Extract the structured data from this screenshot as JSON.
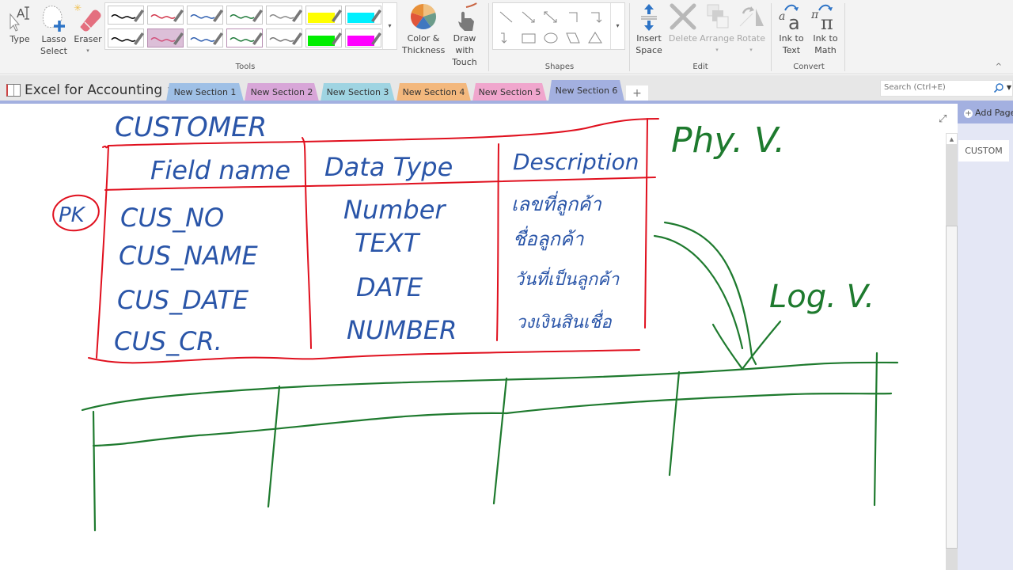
{
  "ribbon": {
    "tools": {
      "type_label": "Type",
      "lasso_label_line1": "Lasso",
      "lasso_label_line2": "Select",
      "eraser_label": "Eraser",
      "color_thickness_line1": "Color &",
      "color_thickness_line2": "Thickness",
      "draw_touch_line1": "Draw with",
      "draw_touch_line2": "Touch",
      "group_label": "Tools",
      "pens": [
        {
          "color": "#000000",
          "kind": "pen"
        },
        {
          "color": "#d2344a",
          "kind": "pen"
        },
        {
          "color": "#2f5fb0",
          "kind": "pen"
        },
        {
          "color": "#1f7a3a",
          "kind": "pen"
        },
        {
          "color": "#888888",
          "kind": "pen"
        },
        {
          "color": "#ffff00",
          "kind": "highlighter"
        },
        {
          "color": "#00f0ff",
          "kind": "highlighter"
        },
        {
          "color": "#000000",
          "kind": "pen"
        },
        {
          "color": "#d2507a",
          "kind": "pen",
          "selected": true
        },
        {
          "color": "#2f5fb0",
          "kind": "pen"
        },
        {
          "color": "#1f7a3a",
          "kind": "pen",
          "outlined": true
        },
        {
          "color": "#777777",
          "kind": "pen"
        },
        {
          "color": "#00ee00",
          "kind": "highlighter"
        },
        {
          "color": "#ff00ff",
          "kind": "highlighter"
        }
      ]
    },
    "shapes": {
      "group_label": "Shapes"
    },
    "edit": {
      "insert_space_line1": "Insert",
      "insert_space_line2": "Space",
      "delete_label": "Delete",
      "arrange_label": "Arrange",
      "rotate_label": "Rotate",
      "group_label": "Edit"
    },
    "convert": {
      "ink_to_text_line1": "Ink to",
      "ink_to_text_line2": "Text",
      "ink_to_math_line1": "Ink to",
      "ink_to_math_line2": "Math",
      "group_label": "Convert"
    }
  },
  "notebook": {
    "name": "Excel for Accounting"
  },
  "sections": [
    {
      "label": "New Section 1",
      "color": "#9fc0e6"
    },
    {
      "label": "New Section 2",
      "color": "#d8a6d8"
    },
    {
      "label": "New Section 3",
      "color": "#9fd4e2"
    },
    {
      "label": "New Section 4",
      "color": "#f3b87d"
    },
    {
      "label": "New Section 5",
      "color": "#f0a6cd"
    },
    {
      "label": "New Section 6",
      "color": "#a3b0e0",
      "active": true
    }
  ],
  "add_section": "+",
  "search": {
    "placeholder": "Search (Ctrl+E)"
  },
  "pages_panel": {
    "add_page_label": "Add Page",
    "pages": [
      "CUSTOM"
    ]
  },
  "ink_content": {
    "table_title": "CUSTOMER",
    "pk_label": "PK",
    "columns": [
      "Field name",
      "Data Type",
      "Description"
    ],
    "rows": [
      [
        "CUS_NO",
        "Number",
        "เลขที่ลูกค้า"
      ],
      [
        "CUS_NAME",
        "TEXT",
        "ชื่อลูกค้า"
      ],
      [
        "CUS_DATE",
        "DATE",
        "วันที่เป็นลูกค้า"
      ],
      [
        "CUS_CR.",
        "NUMBER",
        "วงเงินสินเชื่อ"
      ]
    ],
    "physical_view_label": "Phy. V.",
    "logical_view_label": "Log. V.",
    "ink_colors": {
      "text": "#2a55a8",
      "table": "#e0101e",
      "diagram": "#1e7a2e"
    }
  }
}
